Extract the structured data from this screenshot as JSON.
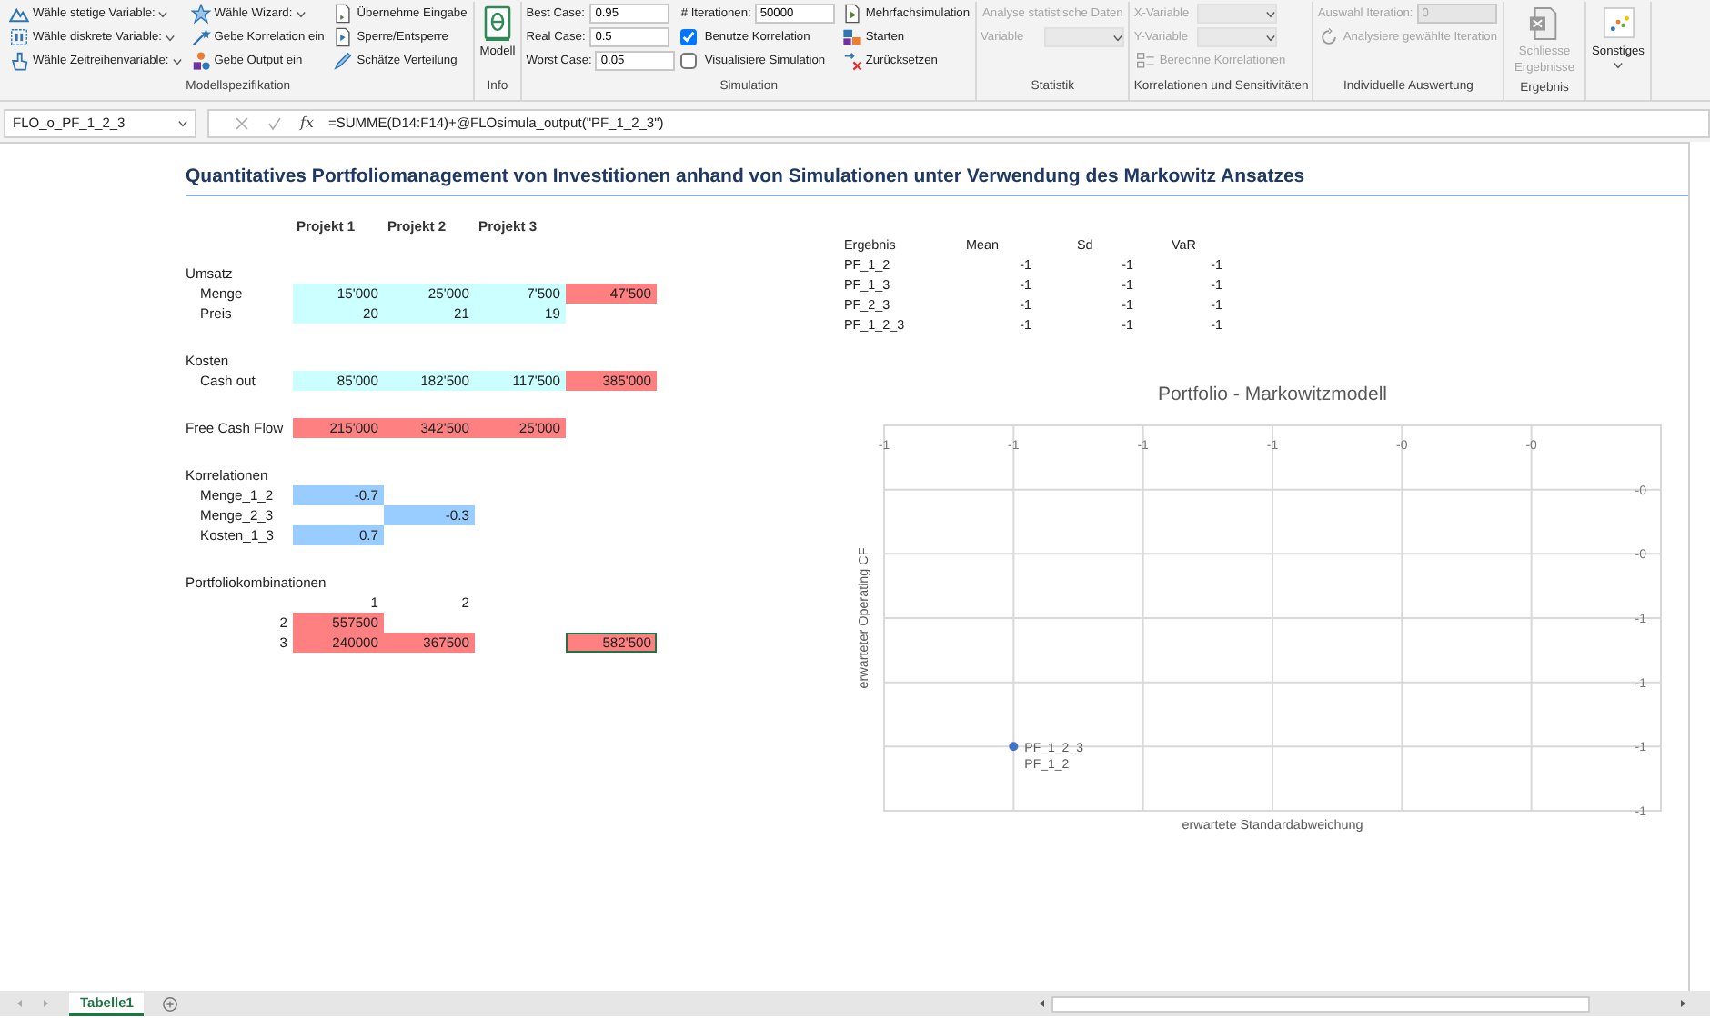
{
  "ribbon": {
    "groups": [
      {
        "label": "Modellspezifikation",
        "columns": [
          [
            {
              "kind": "dropdown",
              "label": "Wähle stetige Variable:",
              "disabled": false
            },
            {
              "kind": "dropdown",
              "label": "Wähle diskrete Variable:",
              "disabled": false
            },
            {
              "kind": "dropdown",
              "label": "Wähle Zeitreihenvariable:",
              "disabled": false
            }
          ],
          [
            {
              "kind": "dropdown",
              "label": "Wähle Wizard:",
              "disabled": false
            },
            {
              "kind": "button",
              "label": "Gebe Korrelation ein",
              "disabled": false
            },
            {
              "kind": "button",
              "label": "Gebe Output ein",
              "disabled": false
            }
          ],
          [
            {
              "kind": "button",
              "label": "Übernehme Eingabe",
              "disabled": false
            },
            {
              "kind": "button",
              "label": "Sperre/Entsperre",
              "disabled": false
            },
            {
              "kind": "button",
              "label": "Schätze Verteilung",
              "disabled": false
            }
          ]
        ]
      },
      {
        "label": "Info",
        "columns": [
          [
            {
              "kind": "large",
              "label": "Modell",
              "disabled": false
            }
          ]
        ]
      },
      {
        "label": "Simulation",
        "columns": [
          [
            {
              "kind": "field",
              "label": "Best Case:",
              "value": "0.95",
              "disabled": false
            },
            {
              "kind": "field",
              "label": "Real Case:",
              "value": "0.5",
              "disabled": false
            },
            {
              "kind": "field",
              "label": "Worst Case:",
              "value": "0.05",
              "disabled": false
            }
          ],
          [
            {
              "kind": "field",
              "label": "# Iterationen:",
              "value": "50000",
              "disabled": false
            },
            {
              "kind": "checkbox",
              "label": "Benutze Korrelation",
              "checked": true,
              "disabled": false
            },
            {
              "kind": "checkbox",
              "label": "Visualisiere Simulation",
              "checked": false,
              "disabled": false
            }
          ],
          [
            {
              "kind": "button",
              "label": "Mehrfachsimulation",
              "disabled": false
            },
            {
              "kind": "button",
              "label": "Starten",
              "disabled": false
            },
            {
              "kind": "button",
              "label": "Zurücksetzen",
              "disabled": false
            }
          ]
        ]
      },
      {
        "label": "Statistik",
        "columns": [
          [
            {
              "kind": "text",
              "label": "Analyse statistische Daten",
              "disabled": true
            },
            {
              "kind": "select",
              "label": "Variable",
              "disabled": true
            }
          ]
        ]
      },
      {
        "label": "Korrelationen und Sensitivitäten",
        "columns": [
          [
            {
              "kind": "select",
              "label": "X-Variable",
              "disabled": true
            },
            {
              "kind": "select",
              "label": "Y-Variable",
              "disabled": true
            },
            {
              "kind": "button",
              "label": "Berechne Korrelationen",
              "disabled": true
            }
          ]
        ]
      },
      {
        "label": "Individuelle Auswertung",
        "columns": [
          [
            {
              "kind": "field",
              "label": "Auswahl Iteration:",
              "value": "0",
              "disabled": true
            },
            {
              "kind": "button",
              "label": "Analysiere gewählte Iteration",
              "disabled": true
            }
          ]
        ]
      },
      {
        "label": "Ergebnis",
        "columns": [
          [
            {
              "kind": "large",
              "label": "Schliesse Ergebnisse",
              "disabled": true
            }
          ]
        ]
      },
      {
        "columns": [
          [
            {
              "kind": "large-dropdown",
              "label": "Sonstiges",
              "disabled": false
            }
          ]
        ]
      }
    ]
  },
  "formula_bar": {
    "name_box": "FLO_o_PF_1_2_3",
    "function_label": "fx",
    "formula": "=SUMME(D14:F14)+@FLOsimula_output(\"PF_1_2_3\")"
  },
  "sheet": {
    "title": "Quantitatives Portfoliomanagement von Investitionen anhand von Simulationen unter Verwendung des Markowitz Ansatzes",
    "model": {
      "header": [
        "Projekt 1",
        "Projekt 2",
        "Projekt 3"
      ],
      "sections": [
        {
          "heading": "Umsatz",
          "rows": [
            {
              "kind": "item",
              "label": "Menge",
              "cells": [
                {
                  "text": "15'000",
                  "kind": "input",
                  "selected": false
                },
                {
                  "text": "25'000",
                  "kind": "input",
                  "selected": false
                },
                {
                  "text": "7'500",
                  "kind": "input",
                  "selected": false
                },
                {
                  "text": "47'500",
                  "kind": "output",
                  "selected": false
                }
              ]
            },
            {
              "kind": "item",
              "label": "Preis",
              "cells": [
                {
                  "text": "20",
                  "kind": "input",
                  "selected": false
                },
                {
                  "text": "21",
                  "kind": "input",
                  "selected": false
                },
                {
                  "text": "19",
                  "kind": "input",
                  "selected": false
                }
              ]
            }
          ]
        },
        {
          "heading": "Kosten",
          "rows": [
            {
              "kind": "item",
              "label": "Cash out",
              "cells": [
                {
                  "text": "85'000",
                  "kind": "input",
                  "selected": false
                },
                {
                  "text": "182'500",
                  "kind": "input",
                  "selected": false
                },
                {
                  "text": "117'500",
                  "kind": "input",
                  "selected": false
                },
                {
                  "text": "385'000",
                  "kind": "output",
                  "selected": false
                }
              ]
            }
          ]
        },
        {
          "rows": [
            {
              "kind": "item",
              "label": "Free Cash Flow",
              "cells": [
                {
                  "text": "215'000",
                  "kind": "output",
                  "selected": false
                },
                {
                  "text": "342'500",
                  "kind": "output",
                  "selected": false
                },
                {
                  "text": "25'000",
                  "kind": "output",
                  "selected": false
                }
              ]
            }
          ]
        },
        {
          "heading": "Korrelationen",
          "rows": [
            {
              "kind": "item",
              "label": "Menge_1_2",
              "cells": [
                {
                  "text": "-0.7",
                  "kind": "correlation",
                  "selected": false
                }
              ]
            },
            {
              "kind": "item",
              "label": "Menge_2_3",
              "cells": [
                {
                  "kind": "blank"
                },
                {
                  "text": "-0.3",
                  "kind": "correlation",
                  "selected": false
                }
              ]
            },
            {
              "kind": "item",
              "label": "Kosten_1_3",
              "cells": [
                {
                  "text": "0.7",
                  "kind": "correlation",
                  "selected": false
                }
              ]
            }
          ]
        },
        {
          "heading": "Portfoliokombinationen",
          "rows": [
            {
              "kind": "matrix-header",
              "cells": [
                {
                  "text": "1",
                  "kind": "plain",
                  "selected": false
                },
                {
                  "text": "2",
                  "kind": "plain",
                  "selected": false
                }
              ]
            },
            {
              "kind": "matrix",
              "label": "2",
              "cells": [
                {
                  "text": "557500",
                  "kind": "output",
                  "selected": false
                }
              ]
            },
            {
              "kind": "matrix",
              "label": "3",
              "cells": [
                {
                  "text": "240000",
                  "kind": "output",
                  "selected": false
                },
                {
                  "text": "367500",
                  "kind": "output",
                  "selected": false
                },
                {
                  "kind": "blank"
                },
                {
                  "text": "582'500",
                  "kind": "output",
                  "selected": true
                }
              ]
            }
          ]
        }
      ]
    },
    "results": {
      "columns": [
        "Ergebnis",
        "Mean",
        "Sd",
        "VaR"
      ],
      "rows": [
        {
          "name": "PF_1_2",
          "mean": "-1",
          "sd": "-1",
          "var": "-1"
        },
        {
          "name": "PF_1_3",
          "mean": "-1",
          "sd": "-1",
          "var": "-1"
        },
        {
          "name": "PF_2_3",
          "mean": "-1",
          "sd": "-1",
          "var": "-1"
        },
        {
          "name": "PF_1_2_3",
          "mean": "-1",
          "sd": "-1",
          "var": "-1"
        }
      ]
    },
    "chart": {
      "chart_data": {
        "type": "scatter",
        "grid": true,
        "title": "Portfolio - Markowitzmodell",
        "xlabel": "erwartete Standardabweichung",
        "ylabel": "erwarteter Operating CF",
        "x": [
          -1
        ],
        "series": [
          {
            "color": "#4472c4",
            "values": [
              -1
            ]
          }
        ],
        "xlim": [
          -1.2,
          0
        ],
        "ylim": [
          -1.2,
          0
        ],
        "xticks": [
          {
            "value": -1.2,
            "label": "-1"
          },
          {
            "value": -1.0,
            "label": "-1"
          },
          {
            "value": -0.8,
            "label": "-1"
          },
          {
            "value": -0.6,
            "label": "-1"
          },
          {
            "value": -0.4,
            "label": "-0"
          },
          {
            "value": -0.2,
            "label": "-0"
          }
        ],
        "yticks": [
          {
            "value": -1.2,
            "label": "-1"
          },
          {
            "value": -1.0,
            "label": "-1"
          },
          {
            "value": -0.8,
            "label": "-1"
          },
          {
            "value": -0.6,
            "label": "-1"
          },
          {
            "value": -0.4,
            "label": "-0"
          },
          {
            "value": -0.2,
            "label": "-0"
          }
        ],
        "annotations": [
          {
            "x": -1,
            "y": -1,
            "text": "PF_1_2_3"
          },
          {
            "x": -1,
            "y": -1,
            "text": "PF_1_2"
          }
        ]
      }
    }
  },
  "sheet_tabs": [
    {
      "label": "Tabelle1",
      "selected": true
    }
  ]
}
